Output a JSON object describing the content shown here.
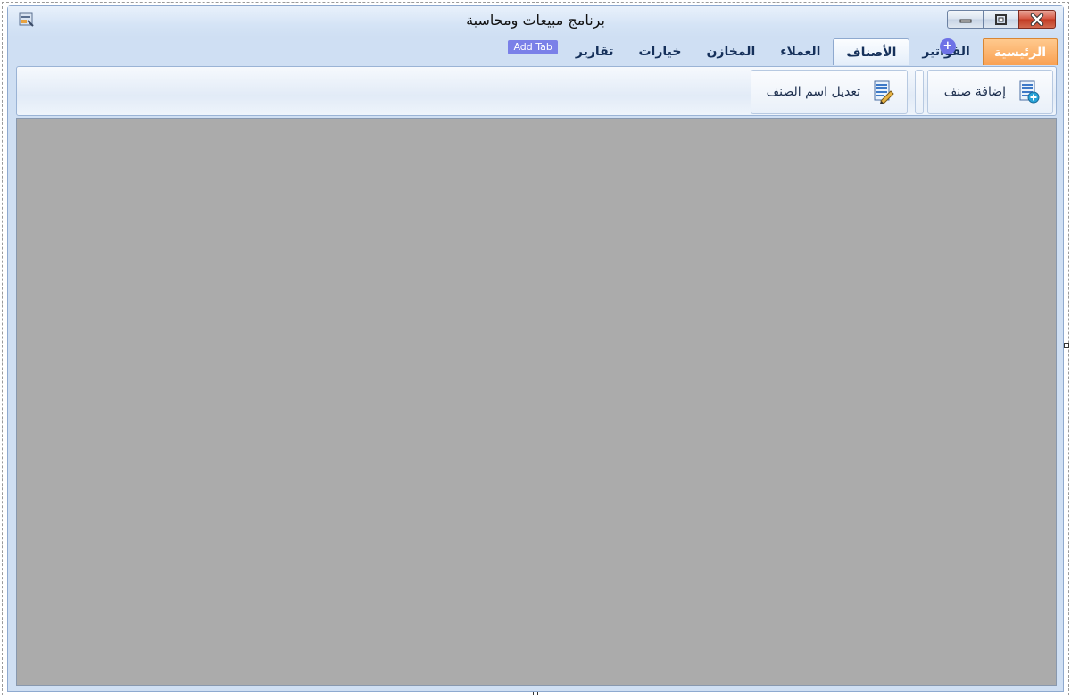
{
  "window": {
    "title": "برنامج مبيعات ومحاسبة",
    "icon": "app-icon",
    "controls": [
      "minimize-icon",
      "maximize-icon",
      "close-icon"
    ]
  },
  "ribbon": {
    "app_menu_label": "الرئيسية",
    "tabs": [
      {
        "label": "الفواتير",
        "active": false
      },
      {
        "label": "الأصناف",
        "active": true
      },
      {
        "label": "العملاء",
        "active": false
      },
      {
        "label": "المخازن",
        "active": false
      },
      {
        "label": "خيارات",
        "active": false
      },
      {
        "label": "تقارير",
        "active": false
      }
    ],
    "plus_badge": "+",
    "add_tab_label": "Add Tab",
    "groups": [
      {
        "button_label": "إضافة صنف",
        "icon": "add-document-icon"
      },
      {
        "button_label": "تعديل اسم الصنف",
        "icon": "edit-document-icon"
      }
    ]
  },
  "colors": {
    "app_menu": "#f9a153",
    "client_area": "#ababab",
    "ribbon_bg": "#e2ebf7",
    "add_tab": "#7a80e8"
  }
}
